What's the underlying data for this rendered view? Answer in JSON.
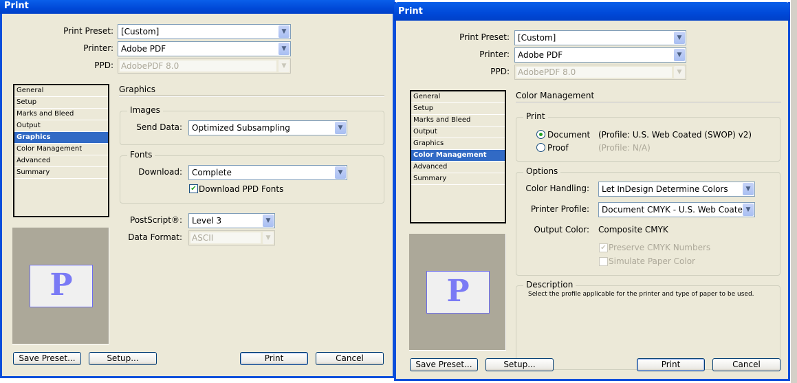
{
  "dialogs": [
    {
      "title": "Print",
      "print_preset_label": "Print Preset:",
      "print_preset": "[Custom]",
      "printer_label": "Printer:",
      "printer": "Adobe PDF",
      "ppd_label": "PPD:",
      "ppd": "AdobePDF 8.0",
      "nav": [
        "General",
        "Setup",
        "Marks and Bleed",
        "Output",
        "Graphics",
        "Color Management",
        "Advanced",
        "Summary"
      ],
      "selected": "Graphics",
      "section_title": "Graphics",
      "images_group": "Images",
      "send_data_label": "Send Data:",
      "send_data": "Optimized Subsampling",
      "fonts_group": "Fonts",
      "download_label": "Download:",
      "download": "Complete",
      "download_ppd_fonts": "Download PPD Fonts",
      "download_ppd_fonts_checked": true,
      "postscript_label": "PostScript®:",
      "postscript": "Level 3",
      "data_format_label": "Data Format:",
      "data_format": "ASCII",
      "preview_letter": "P",
      "buttons": {
        "save_preset": "Save Preset...",
        "setup": "Setup...",
        "print": "Print",
        "cancel": "Cancel"
      }
    },
    {
      "title": "Print",
      "print_preset_label": "Print Preset:",
      "print_preset": "[Custom]",
      "printer_label": "Printer:",
      "printer": "Adobe PDF",
      "ppd_label": "PPD:",
      "ppd": "AdobePDF 8.0",
      "nav": [
        "General",
        "Setup",
        "Marks and Bleed",
        "Output",
        "Graphics",
        "Color Management",
        "Advanced",
        "Summary"
      ],
      "selected": "Color Management",
      "section_title": "Color Management",
      "print_group": "Print",
      "document_label": "Document",
      "document_profile": "(Profile: U.S. Web Coated (SWOP) v2)",
      "proof_label": "Proof",
      "proof_profile": "(Profile: N/A)",
      "options_group": "Options",
      "color_handling_label": "Color Handling:",
      "color_handling": "Let InDesign Determine Colors",
      "printer_profile_label": "Printer Profile:",
      "printer_profile": "Document CMYK - U.S. Web Coated",
      "output_color_label": "Output Color:",
      "output_color": "Composite CMYK",
      "preserve_cmyk": "Preserve CMYK Numbers",
      "simulate_paper": "Simulate Paper Color",
      "description_group": "Description",
      "description": "Select the profile applicable for the printer and type of paper to be used.",
      "preview_letter": "P",
      "buttons": {
        "save_preset": "Save Preset...",
        "setup": "Setup...",
        "print": "Print",
        "cancel": "Cancel"
      }
    }
  ]
}
